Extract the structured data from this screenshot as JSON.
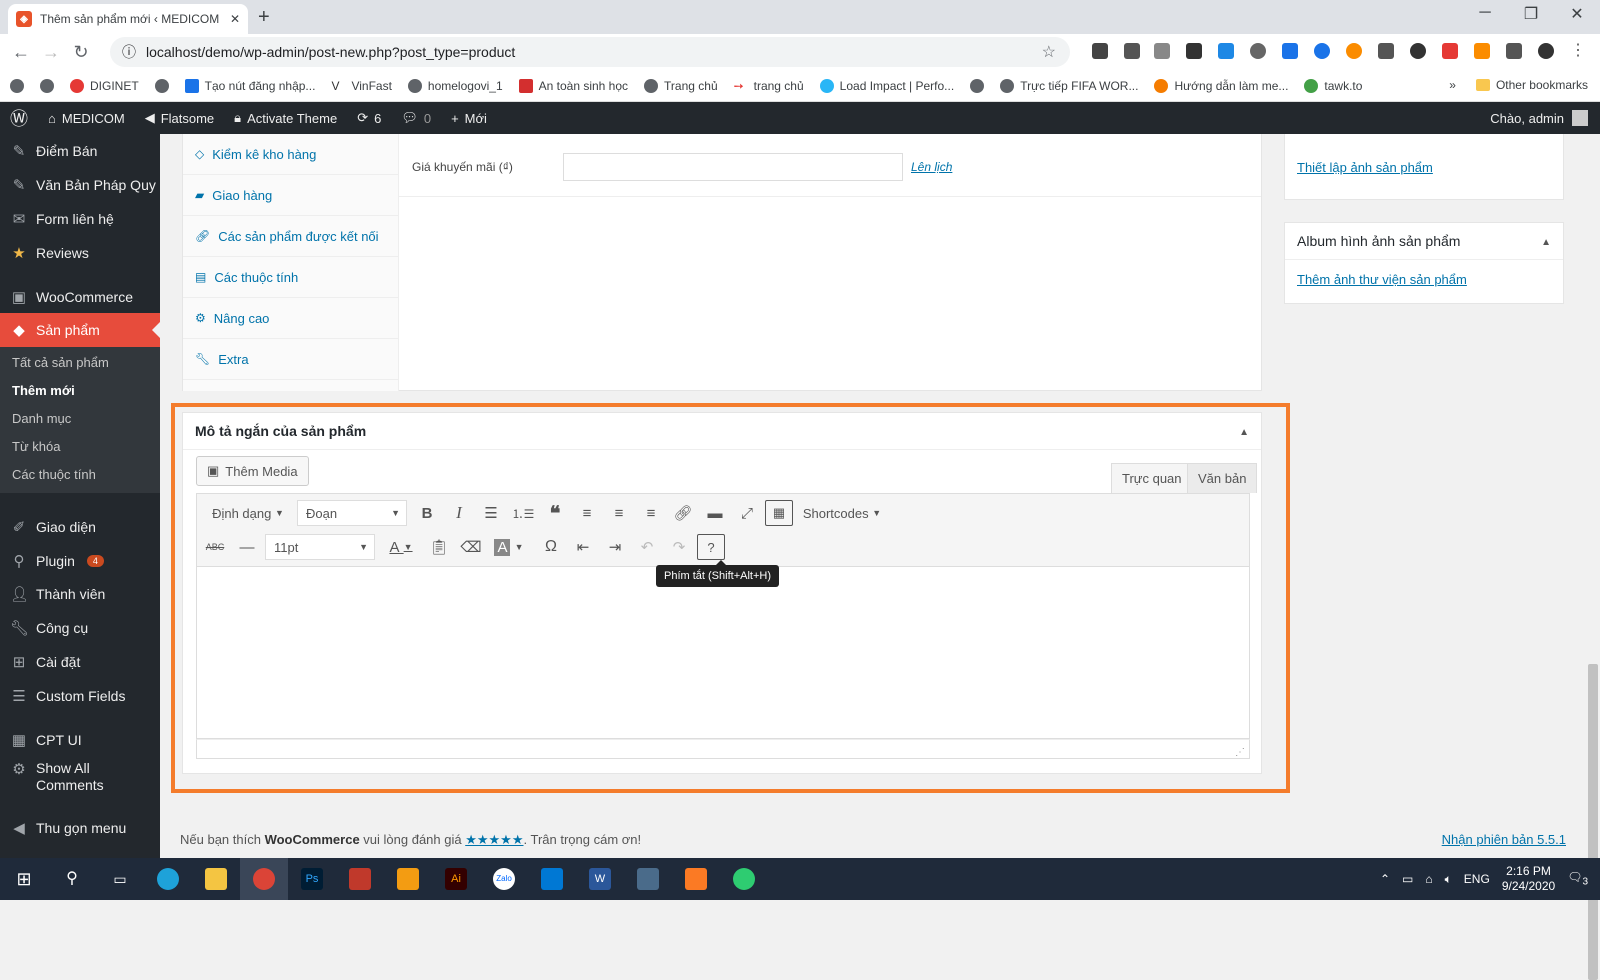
{
  "browser": {
    "tab_title": "Thêm sản phẩm mới ‹ MEDICOM",
    "url": "localhost/demo/wp-admin/post-new.php?post_type=product",
    "bookmarks": [
      "DIGINET",
      "Tạo nút đăng nhập...",
      "VinFast",
      "homelogovi_1",
      "An toàn sinh học",
      "Trang chủ",
      "trang chủ",
      "Load Impact | Perfo...",
      "Trực tiếp FIFA WOR...",
      "Hướng dẫn làm me...",
      "tawk.to"
    ],
    "more_bookmarks": "»",
    "other_bookmarks": "Other bookmarks"
  },
  "adminbar": {
    "site": "MEDICOM",
    "theme": "Flatsome",
    "activate": "Activate Theme",
    "updates": "6",
    "comments": "0",
    "new": "Mới",
    "greeting": "Chào, admin"
  },
  "sidebar": {
    "items": [
      {
        "label": "Điểm Bán",
        "icon": "pin-icon"
      },
      {
        "label": "Văn Bản Pháp Quy",
        "icon": "pin-icon"
      },
      {
        "label": "Form liên hệ",
        "icon": "mail-icon"
      },
      {
        "label": "Reviews",
        "icon": "star-icon"
      },
      {
        "label": "WooCommerce",
        "icon": "woo-icon"
      },
      {
        "label": "Sản phẩm",
        "icon": "box-icon"
      }
    ],
    "submenu": [
      "Tất cả sản phẩm",
      "Thêm mới",
      "Danh mục",
      "Từ khóa",
      "Các thuộc tính"
    ],
    "items2": [
      {
        "label": "Giao diện",
        "icon": "brush-icon"
      },
      {
        "label": "Plugin",
        "icon": "plug-icon",
        "badge": "4"
      },
      {
        "label": "Thành viên",
        "icon": "user-icon"
      },
      {
        "label": "Công cụ",
        "icon": "wrench-icon"
      },
      {
        "label": "Cài đặt",
        "icon": "settings-icon"
      },
      {
        "label": "Custom Fields",
        "icon": "fields-icon"
      },
      {
        "label": "CPT UI",
        "icon": "grid-icon"
      },
      {
        "label": "Show All",
        "label2": "Comments",
        "icon": "gear-icon"
      },
      {
        "label": "Thu gọn menu",
        "icon": "collapse-icon"
      }
    ]
  },
  "product_data": {
    "tabs": [
      "Kiểm kê kho hàng",
      "Giao hàng",
      "Các sản phẩm được kết nối",
      "Các thuộc tính",
      "Nâng cao",
      "Extra"
    ],
    "sale_label": "Giá khuyến mãi (₫)",
    "schedule": "Lên lịch"
  },
  "right": {
    "set_image": "Thiết lập ảnh sản phẩm",
    "gallery_title": "Album hình ảnh sản phẩm",
    "gallery_link": "Thêm ảnh thư viện sản phẩm"
  },
  "short_desc": {
    "title": "Mô tả ngắn của sản phẩm",
    "add_media": "Thêm Media",
    "tab_visual": "Trực quan",
    "tab_text": "Văn bản",
    "format": "Định dạng",
    "block": "Đoạn",
    "shortcodes": "Shortcodes",
    "font_size": "11pt",
    "tooltip": "Phím tắt (Shift+Alt+H)"
  },
  "footer": {
    "pre": "Nếu bạn thích ",
    "brand": "WooCommerce",
    "mid": " vui lòng đánh giá ",
    "stars": "★★★★★",
    "post": ". Trân trọng cám ơn!",
    "version": "Nhận phiên bản 5.5.1"
  },
  "taskbar": {
    "lang": "ENG",
    "time": "2:16 PM",
    "date": "9/24/2020",
    "notif": "3"
  }
}
